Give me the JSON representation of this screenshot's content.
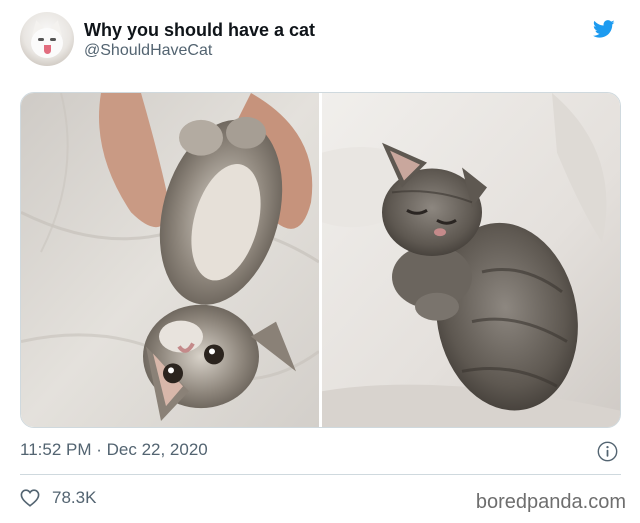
{
  "tweet": {
    "author": {
      "display_name": "Why you should have a cat",
      "handle": "@ShouldHaveCat",
      "avatar_icon": "kitten-avatar"
    },
    "platform_icon": "twitter-bird-icon",
    "brand_color": "#1d9bf0",
    "media": [
      {
        "icon": "kitten-belly-up-photo"
      },
      {
        "icon": "kitten-sleeping-photo"
      }
    ],
    "timestamp": "11:52 PM · Dec 22, 2020",
    "likes": "78.3K"
  },
  "watermark": "boredpanda.com"
}
